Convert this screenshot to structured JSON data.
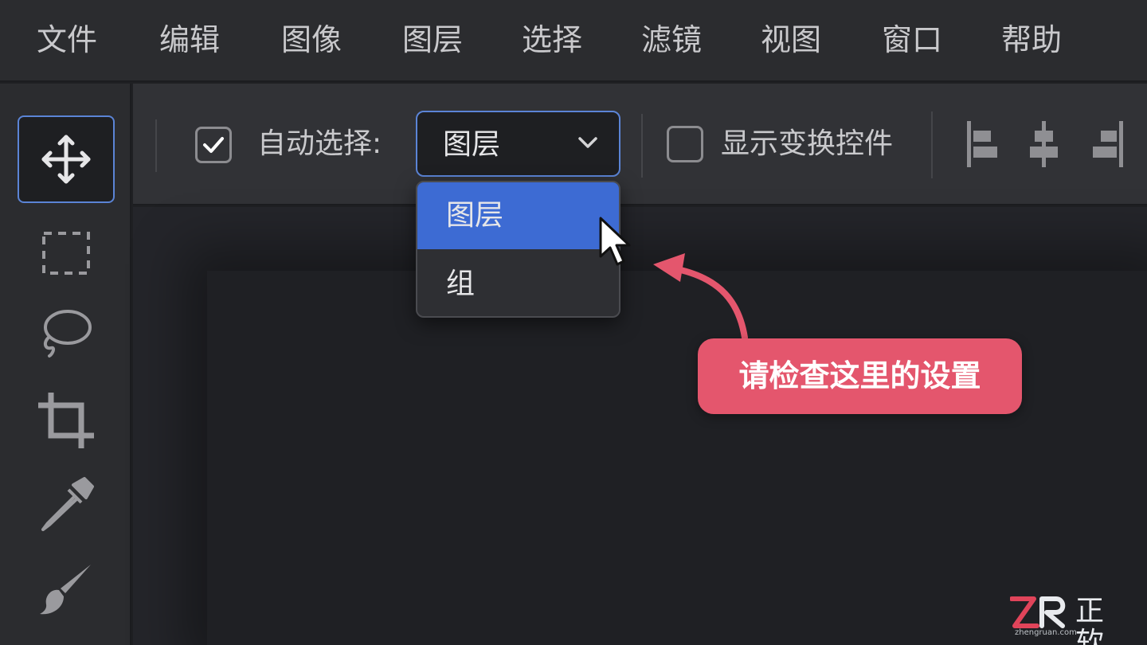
{
  "menu": [
    "文件",
    "编辑",
    "图像",
    "图层",
    "选择",
    "滤镜",
    "视图",
    "窗口",
    "帮助"
  ],
  "tools": [
    {
      "icon": "move-icon",
      "active": true
    },
    {
      "icon": "marquee-icon",
      "active": false
    },
    {
      "icon": "lasso-icon",
      "active": false
    },
    {
      "icon": "crop-icon",
      "active": false
    },
    {
      "icon": "eyedropper-icon",
      "active": false
    },
    {
      "icon": "brush-icon",
      "active": false
    }
  ],
  "options": {
    "auto_select": {
      "label": "自动选择:",
      "checked": true
    },
    "select": {
      "value": "图层",
      "options": [
        "图层",
        "组"
      ]
    },
    "transform_controls": {
      "label": "显示变换控件",
      "checked": false
    },
    "align_icons": [
      "align-left-icon",
      "align-center-icon",
      "align-right-icon"
    ]
  },
  "dropdown": {
    "selected": "图层",
    "items": [
      "图层",
      "组"
    ]
  },
  "annotation": {
    "text": "请检查这里的设置",
    "color": "#e4566d"
  },
  "watermark": {
    "logo": "ZR",
    "name": "正软",
    "url": "zhengruan.com"
  },
  "colors": {
    "accent": "#3d6bd3",
    "focus_border": "#5b84d6",
    "callout": "#e4566d",
    "watermark_red": "#e0445a"
  }
}
